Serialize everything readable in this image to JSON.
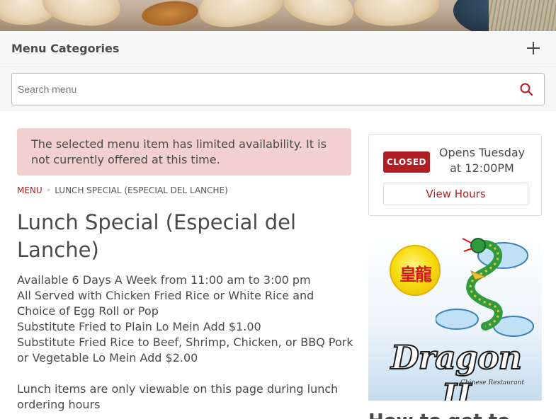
{
  "categories": {
    "title": "Menu Categories"
  },
  "search": {
    "placeholder": "Search menu"
  },
  "alert": {
    "message": "The selected menu item has limited availability. It is not currently offered at this time."
  },
  "breadcrumb": {
    "root": "MENU",
    "separator": "»",
    "current": "LUNCH SPECIAL (ESPECIAL DEL LANCHE)"
  },
  "item": {
    "title": "Lunch Special (Especial del Lanche)",
    "description_lines": [
      "Available 6 Days A Week from 11:00 am to 3:00 pm",
      "All Served with Chicken Fried Rice or White Rice and Choice of Egg Roll or Pop",
      "Substitute Fried to Plain Lo Mein Add $1.00",
      "Substitute Fried Rice to Beef, Shrimp, Chicken, or BBQ Pork or Vegetable Lo Mein Add $2.00"
    ],
    "note": "Lunch items are only viewable on this page during lunch ordering hours"
  },
  "status": {
    "badge": "CLOSED",
    "opens": "Opens Tuesday at 12:00PM",
    "view_hours": "View Hours"
  },
  "logo": {
    "chinese_text": "皇龍",
    "brand_text": "Dragon II",
    "subtitle": "Chinese Restaurant"
  },
  "sidebar": {
    "cutoff_heading": "How to get to"
  },
  "colors": {
    "accent": "#b01f24",
    "alert_bg": "#f2d0d0",
    "bar_bg": "#f7f7f7",
    "text": "#4a4a4a"
  },
  "icons": {
    "expand": "plus-icon",
    "search": "search-icon"
  }
}
